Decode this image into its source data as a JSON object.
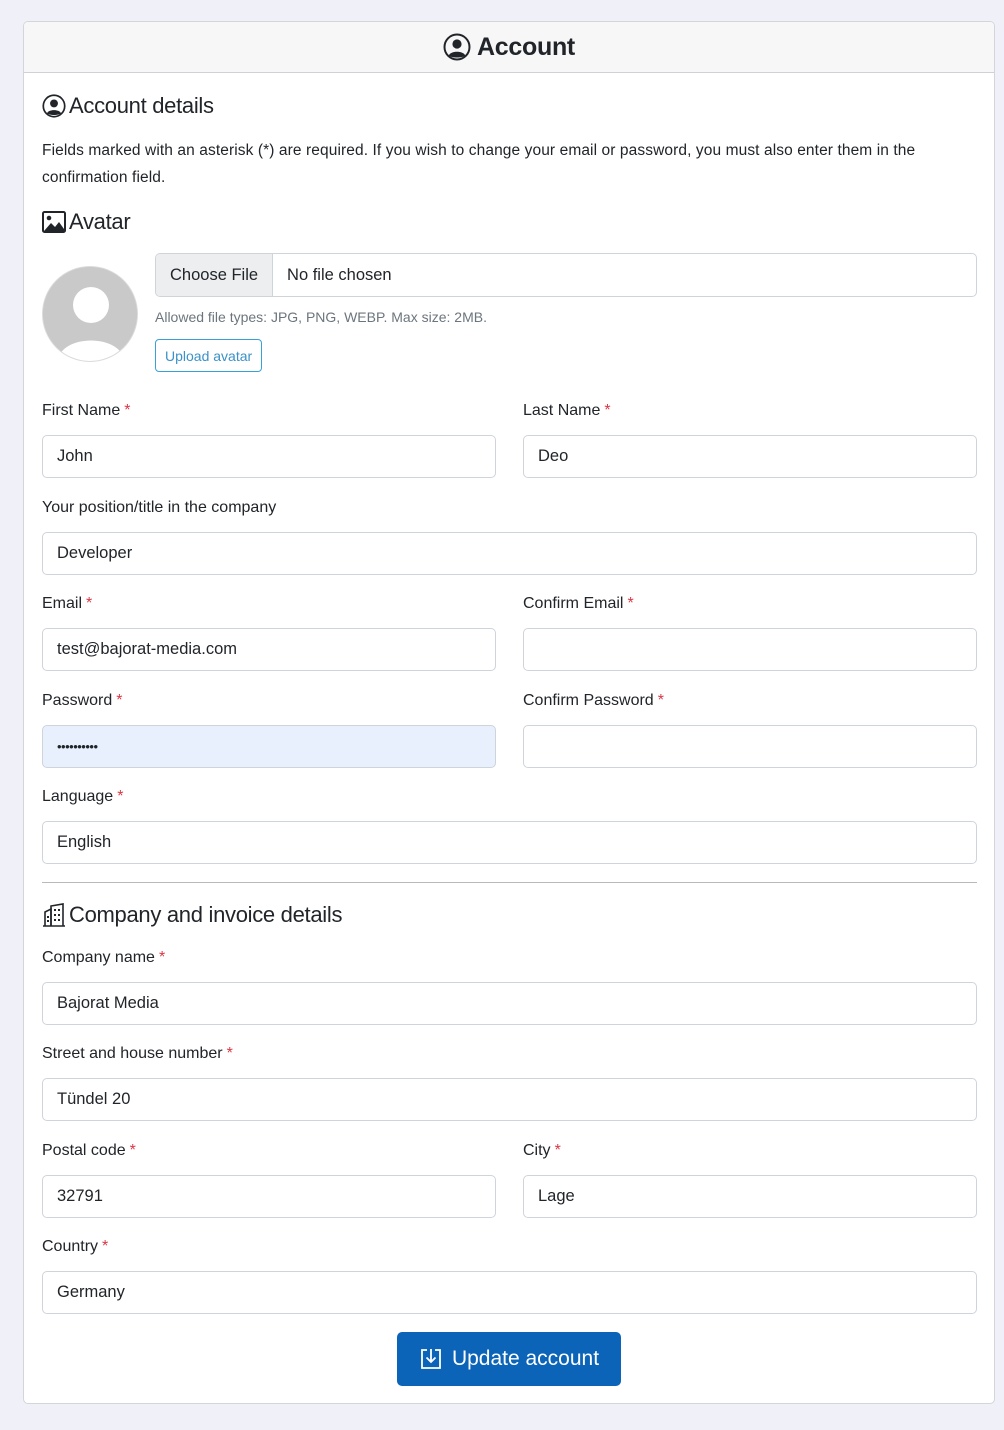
{
  "header": {
    "title": "Account",
    "icon": "user-circle-icon"
  },
  "account_details": {
    "title": "Account details",
    "icon": "user-circle-icon",
    "help_text": "Fields marked with an asterisk (*) are required. If you wish to change your email or password, you must also enter them in the confirmation field."
  },
  "avatar": {
    "title": "Avatar",
    "icon": "image-icon",
    "choose_file_label": "Choose File",
    "file_status": "No file chosen",
    "allowed_text": "Allowed file types: JPG, PNG, WEBP. Max size: 2MB.",
    "upload_label": "Upload avatar"
  },
  "fields": {
    "first_name": {
      "label": "First Name",
      "value": "John",
      "required": "*"
    },
    "last_name": {
      "label": "Last Name",
      "value": "Deo",
      "required": "*"
    },
    "position": {
      "label": "Your position/title in the company",
      "value": "Developer"
    },
    "email": {
      "label": "Email",
      "value": "test@bajorat-media.com",
      "required": "*"
    },
    "confirm_email": {
      "label": "Confirm Email",
      "value": "",
      "required": "*"
    },
    "password": {
      "label": "Password",
      "value": "••••••••••",
      "required": "*"
    },
    "confirm_password": {
      "label": "Confirm Password",
      "value": "",
      "required": "*"
    },
    "language": {
      "label": "Language",
      "value": "English",
      "required": "*"
    }
  },
  "company": {
    "title": "Company and invoice details",
    "icon": "building-icon",
    "company_name": {
      "label": "Company name",
      "value": "Bajorat Media",
      "required": "*"
    },
    "street": {
      "label": "Street and house number",
      "value": "Tündel 20",
      "required": "*"
    },
    "postal_code": {
      "label": "Postal code",
      "value": "32791",
      "required": "*"
    },
    "city": {
      "label": "City",
      "value": "Lage",
      "required": "*"
    },
    "country": {
      "label": "Country",
      "value": "Germany",
      "required": "*"
    }
  },
  "submit": {
    "label": "Update account",
    "icon": "download-box-icon"
  },
  "colors": {
    "primary": "#0b64b8",
    "required": "#dc3545",
    "outline": "#3aa1d8",
    "background": "#eff0f8"
  }
}
